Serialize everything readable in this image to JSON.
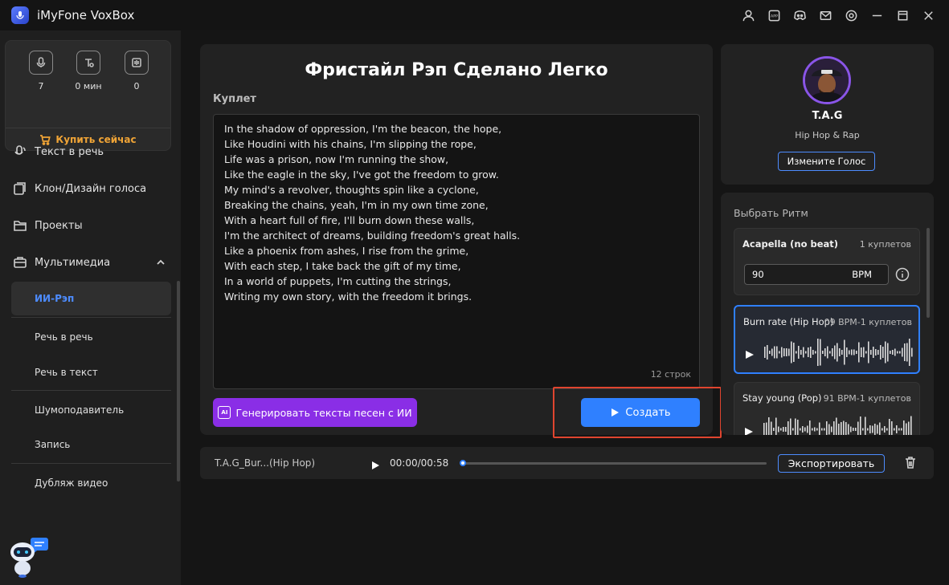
{
  "app": {
    "title": "iMyFone VoxBox"
  },
  "titlebar_icons": [
    "user-icon",
    "app-icon",
    "discord-icon",
    "mail-icon",
    "settings-icon",
    "minimize-icon",
    "maximize-icon",
    "close-icon"
  ],
  "titlebar_app_label": "APP",
  "stats": [
    {
      "icon": "voice-char-icon",
      "value": "7"
    },
    {
      "icon": "text-minutes-icon",
      "value": "0 мин"
    },
    {
      "icon": "clone-count-icon",
      "value": "0"
    }
  ],
  "buy_label": "Купить сейчас",
  "nav": [
    {
      "id": "tts",
      "label": "Текст в речь",
      "icon": "mic-icon"
    },
    {
      "id": "clone",
      "label": "Клон/Дизайн голоса",
      "icon": "clone-icon"
    },
    {
      "id": "projects",
      "label": "Проекты",
      "icon": "folder-icon"
    },
    {
      "id": "multimedia",
      "label": "Мультимедиа",
      "icon": "briefcase-icon"
    }
  ],
  "subnav": [
    {
      "id": "ai-rap",
      "label": "ИИ-Рэп",
      "active": true
    },
    {
      "id": "speech-to-speech",
      "label": "Речь в речь"
    },
    {
      "id": "speech-to-text",
      "label": "Речь в текст"
    },
    {
      "id": "noise",
      "label": "Шумоподавитель"
    },
    {
      "id": "record",
      "label": "Запись"
    },
    {
      "id": "dubbing",
      "label": "Дубляж видео"
    }
  ],
  "editor": {
    "title": "Фристайл Рэп Сделано Легко",
    "verse_label": "Куплет",
    "lyrics": [
      "In the shadow of oppression, I'm the beacon, the hope,",
      "Like Houdini with his chains, I'm slipping the rope,",
      "Life was a prison, now I'm running the show,",
      "Like the eagle in the sky, I've got the freedom to grow.",
      "My mind's a revolver, thoughts spin like a cyclone,",
      "Breaking the chains, yeah, I'm in my own time zone,",
      "With a heart full of fire, I'll burn down these walls,",
      "I'm the architect of dreams, building freedom's great halls.",
      "Like a phoenix from ashes, I rise from the grime,",
      "With each step, I take back the gift of my time,",
      "In a world of puppets, I'm cutting the strings,",
      "Writing my own story, with the freedom it brings."
    ],
    "line_count": "12 строк",
    "ai_button": "Генерировать тексты песен с ИИ",
    "ai_badge": "AI",
    "create_button": "Создать"
  },
  "artist": {
    "name": "T.A.G",
    "genre": "Hip Hop & Rap",
    "change_button": "Измените Голос"
  },
  "beats": {
    "title": "Выбрать Ритм",
    "items": [
      {
        "name": "Acapella (no beat)",
        "meta": "1 куплетов",
        "bpm": "90",
        "bpm_unit": "BPM"
      },
      {
        "name": "Burn rate (Hip Hop)",
        "meta": "09 BPM-1 куплетов",
        "selected": true
      },
      {
        "name": "Stay young (Pop)",
        "meta": "91 BPM-1 куплетов"
      }
    ]
  },
  "player": {
    "track": "T.A.G_Bur...(Hip Hop)",
    "time": "00:00/00:58",
    "progress": 0,
    "export_button": "Экспортировать"
  },
  "colors": {
    "accent": "#2f80ff",
    "ai_purple": "#8a2ee6",
    "buy_orange": "#f0a436",
    "highlight_red": "#e0452f"
  }
}
